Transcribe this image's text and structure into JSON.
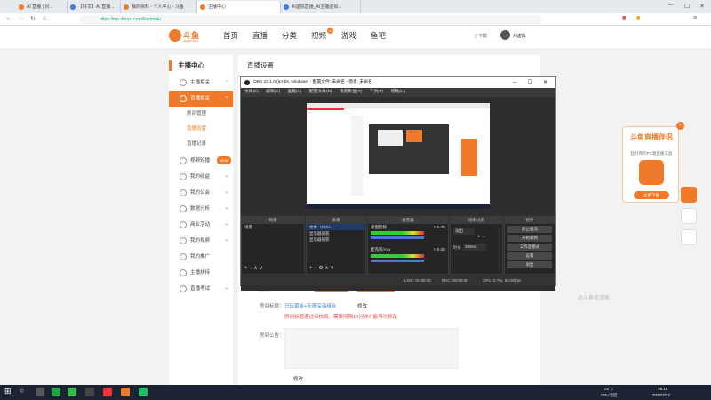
{
  "browser": {
    "tabs": [
      {
        "label": "AI 直播 | 对..."
      },
      {
        "label": "【好文】AI 直播..."
      },
      {
        "label": "我的资料 - 个人中心 - 斗鱼"
      },
      {
        "label": "主播中心"
      },
      {
        "label": "AI虚拟直播_AI主播虚拟..."
      }
    ],
    "url": "https://mp.douyu.com/live/main"
  },
  "site": {
    "logo_text": "斗鱼",
    "logo_sub": "douyu.com",
    "nav": [
      "首页",
      "直播",
      "分类",
      "视频",
      "游戏",
      "鱼吧"
    ],
    "nav_badge": "8",
    "download": "下载",
    "username": "AI虚拟"
  },
  "sidebar": {
    "title": "主播中心",
    "items": [
      {
        "label": "主播相关"
      },
      {
        "label": "直播相关"
      },
      {
        "label": "房间管理"
      },
      {
        "label": "直播设置"
      },
      {
        "label": "直播记录"
      },
      {
        "label": "视频轮播"
      },
      {
        "label": "我的收益"
      },
      {
        "label": "我的公会"
      },
      {
        "label": "数据分析"
      },
      {
        "label": "商业活动"
      },
      {
        "label": "我的视频"
      },
      {
        "label": "我的推广"
      },
      {
        "label": "主播扶持"
      },
      {
        "label": "直播考试"
      }
    ],
    "badge_new": "NEW"
  },
  "content": {
    "title": "直播设置",
    "room_id_label": "房间ID：",
    "room_id_value": "4629405",
    "btn_start": "进入直播间",
    "btn_tool": "下载直播伴侣",
    "room_title_label": "房间标题：",
    "room_title_value": "只玩黄金+无限深海组合",
    "room_title_edit": "修改",
    "room_title_warn": "房间标题通过审核后，需要间隔10分钟才能再次修改",
    "notice_label": "房间公告：",
    "notice_edit": "修改"
  },
  "obs": {
    "title": "OBS 23.1.0 (64-bit, windows) - 配置文件: 未命名 - 场景: 未命名",
    "menu": [
      "文件(F)",
      "编辑(E)",
      "查看(V)",
      "配置文件(P)",
      "场景集合(S)",
      "工具(T)",
      "帮助(H)"
    ],
    "docks": {
      "scenes": {
        "title": "场景",
        "items": [
          "场景"
        ]
      },
      "sources": {
        "title": "来源",
        "items": [
          "文本（GDI+）",
          "显示器捕获",
          "显示器捕获"
        ]
      },
      "mixer": {
        "title": "混音器",
        "tracks": [
          "桌面音频",
          "麦克风/Aux"
        ],
        "levels": [
          "0.0 dB",
          "0.0 dB"
        ]
      },
      "transitions": {
        "title": "场景过渡",
        "type": "淡出",
        "duration_label": "时长",
        "duration": "300ms"
      },
      "controls": {
        "title": "控件",
        "buttons": [
          "停止推流",
          "开始录制",
          "工作室模式",
          "设置",
          "退出"
        ]
      }
    },
    "status": {
      "live": "LIVE: 00:00:00",
      "rec": "REC: 00:00:00",
      "cpu": "CPU: 0.7%, 60.00 fps"
    }
  },
  "ad": {
    "title": "斗鱼直播伴侣",
    "subtitle": "超好用的PC端直播工具",
    "button": "立即下载"
  },
  "taskbar": {
    "time": "18:19",
    "date": "2022/2/27",
    "temp": "26°C",
    "weather": "CPU温度"
  },
  "watermark": "@斗鱼老游鱼"
}
